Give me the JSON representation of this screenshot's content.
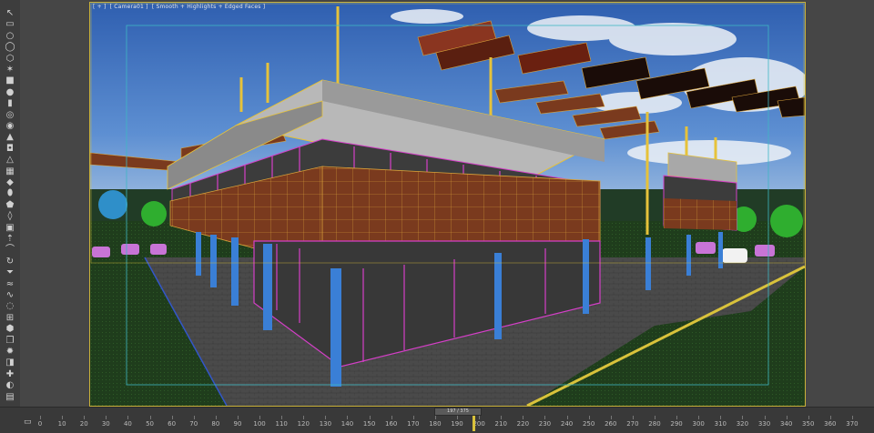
{
  "viewport": {
    "label_parts": [
      "[ + ]",
      "[ Camera01 ]",
      "[ Smooth + Highlights + Edged Faces ]"
    ]
  },
  "toolbar": {
    "tools": [
      {
        "name": "select-object-icon",
        "glyph": "↖"
      },
      {
        "name": "rectangle-icon",
        "glyph": "▭"
      },
      {
        "name": "circle-icon",
        "glyph": "○"
      },
      {
        "name": "ellipse-icon",
        "glyph": "◯"
      },
      {
        "name": "ngon-icon",
        "glyph": "⬡"
      },
      {
        "name": "star-icon",
        "glyph": "✶"
      },
      {
        "name": "box-icon",
        "glyph": "■"
      },
      {
        "name": "sphere-icon",
        "glyph": "●"
      },
      {
        "name": "cylinder-icon",
        "glyph": "▮"
      },
      {
        "name": "torus-icon",
        "glyph": "◎"
      },
      {
        "name": "teapot-icon",
        "glyph": "◉"
      },
      {
        "name": "cone-icon",
        "glyph": "▲"
      },
      {
        "name": "tube-icon",
        "glyph": "◘"
      },
      {
        "name": "pyramid-icon",
        "glyph": "△"
      },
      {
        "name": "plane-icon",
        "glyph": "▦"
      },
      {
        "name": "geosphere-icon",
        "glyph": "◆"
      },
      {
        "name": "capsule-icon",
        "glyph": "⬮"
      },
      {
        "name": "hedra-icon",
        "glyph": "⬟"
      },
      {
        "name": "spindle-icon",
        "glyph": "◊"
      },
      {
        "name": "chamfer-box-icon",
        "glyph": "▣"
      },
      {
        "name": "extrude-icon",
        "glyph": "⇡"
      },
      {
        "name": "bend-icon",
        "glyph": "⌒"
      },
      {
        "name": "twist-icon",
        "glyph": "↻"
      },
      {
        "name": "taper-icon",
        "glyph": "⏷"
      },
      {
        "name": "noise-icon",
        "glyph": "≈"
      },
      {
        "name": "wave-icon",
        "glyph": "∿"
      },
      {
        "name": "ripple-icon",
        "glyph": "◌"
      },
      {
        "name": "lattice-icon",
        "glyph": "⊞"
      },
      {
        "name": "mesh-smooth-icon",
        "glyph": "⬢"
      },
      {
        "name": "shell-icon",
        "glyph": "❐"
      },
      {
        "name": "light-icon",
        "glyph": "✹"
      },
      {
        "name": "camera-icon",
        "glyph": "◨"
      },
      {
        "name": "helper-icon",
        "glyph": "✚"
      },
      {
        "name": "material-icon",
        "glyph": "◐"
      },
      {
        "name": "render-icon",
        "glyph": "▤"
      }
    ]
  },
  "timeline": {
    "frame_display": "197 / 375",
    "current_frame": 197,
    "total_frames": 375,
    "tick_labels": [
      "0",
      "10",
      "20",
      "30",
      "40",
      "50",
      "60",
      "70",
      "80",
      "90",
      "100",
      "110",
      "120",
      "130",
      "140",
      "150",
      "160",
      "170",
      "180",
      "190",
      "200",
      "210",
      "220",
      "230",
      "240",
      "250",
      "260",
      "270",
      "280",
      "290",
      "300",
      "310",
      "320",
      "330",
      "340",
      "350",
      "360",
      "370"
    ]
  },
  "colors": {
    "viewport_border": "#c9b13a",
    "safe_frame": "#3fb7c4",
    "wireframe_magenta": "#d43fc7",
    "wireframe_yellow": "#e6c23a",
    "column_blue": "#3a7fd6",
    "facade_brown": "#7a3a1e"
  }
}
